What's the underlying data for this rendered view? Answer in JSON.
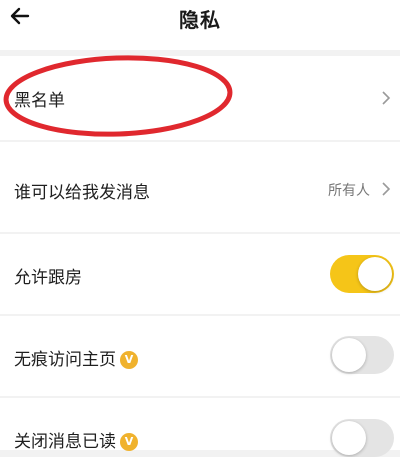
{
  "header": {
    "title": "隐私",
    "back_icon": "arrow-left-icon"
  },
  "rows": [
    {
      "label": "黑名单",
      "chevron_icon": "chevron-right-icon"
    },
    {
      "label": "谁可以给我发消息",
      "value": "所有人",
      "chevron_icon": "chevron-right-icon"
    },
    {
      "label": "允许跟房",
      "toggle_on": true
    },
    {
      "label": "无痕访问主页",
      "badge": "V",
      "toggle_on": false
    },
    {
      "label": "关闭消息已读",
      "badge": "V",
      "toggle_on": false
    }
  ],
  "colors": {
    "toggle_on": "#f5c518",
    "toggle_off": "#e4e4e4",
    "vip_badge": "#f0b22d",
    "highlight_ellipse": "#e0282e"
  }
}
